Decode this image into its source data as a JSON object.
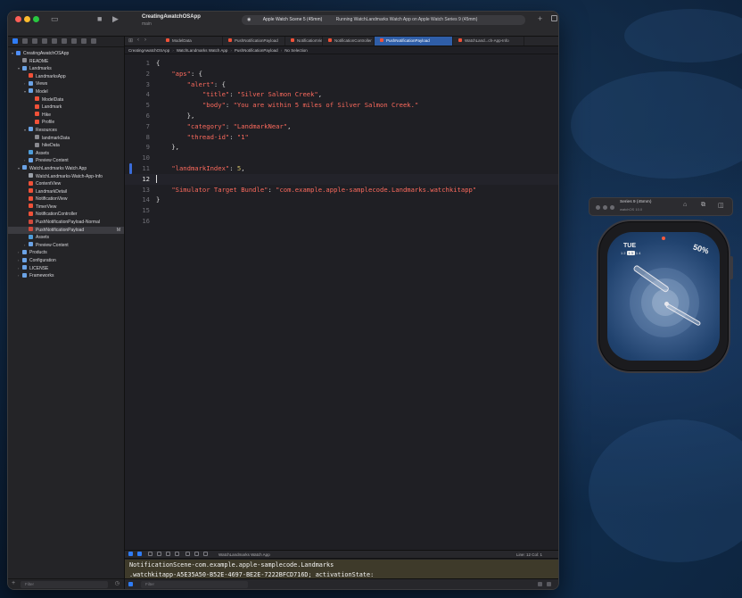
{
  "window": {
    "project_name": "CreatingAwatchOSApp",
    "project_sub": "main",
    "scheme": "Apple Watch Scene 5 (45mm)",
    "run_status": "Running WatchLandmarks Watch App on Apple Watch Series 9 (45mm)"
  },
  "sidebar": {
    "filter_placeholder": "Filter",
    "items": [
      {
        "label": "CreatingAwatchOSApp",
        "depth": 0,
        "arrow": "▾",
        "icon": "proj"
      },
      {
        "label": "README",
        "depth": 1,
        "arrow": "",
        "icon": "json"
      },
      {
        "label": "Landmarks",
        "depth": 1,
        "arrow": "▾",
        "icon": "folder"
      },
      {
        "label": "LandmarksApp",
        "depth": 2,
        "arrow": "",
        "icon": "swift"
      },
      {
        "label": "Views",
        "depth": 2,
        "arrow": "›",
        "icon": "folder"
      },
      {
        "label": "Model",
        "depth": 2,
        "arrow": "▾",
        "icon": "folder"
      },
      {
        "label": "ModelData",
        "depth": 3,
        "arrow": "",
        "icon": "swift"
      },
      {
        "label": "Landmark",
        "depth": 3,
        "arrow": "",
        "icon": "swift"
      },
      {
        "label": "Hike",
        "depth": 3,
        "arrow": "",
        "icon": "swift"
      },
      {
        "label": "Profile",
        "depth": 3,
        "arrow": "",
        "icon": "swift"
      },
      {
        "label": "Resources",
        "depth": 2,
        "arrow": "▾",
        "icon": "folder"
      },
      {
        "label": "landmarkData",
        "depth": 3,
        "arrow": "",
        "icon": "json"
      },
      {
        "label": "hikeData",
        "depth": 3,
        "arrow": "",
        "icon": "json"
      },
      {
        "label": "Assets",
        "depth": 2,
        "arrow": "",
        "icon": "assets"
      },
      {
        "label": "Preview Content",
        "depth": 2,
        "arrow": "›",
        "icon": "folder"
      },
      {
        "label": "WatchLandmarks Watch App",
        "depth": 1,
        "arrow": "▾",
        "icon": "folder"
      },
      {
        "label": "WatchLandmarks-Watch-App-Info",
        "depth": 2,
        "arrow": "",
        "icon": "plist"
      },
      {
        "label": "ContentView",
        "depth": 2,
        "arrow": "",
        "icon": "swift"
      },
      {
        "label": "LandmarkDetail",
        "depth": 2,
        "arrow": "",
        "icon": "swift"
      },
      {
        "label": "NotificationView",
        "depth": 2,
        "arrow": "",
        "icon": "swift"
      },
      {
        "label": "TimerView",
        "depth": 2,
        "arrow": "",
        "icon": "swift"
      },
      {
        "label": "NotificationController",
        "depth": 2,
        "arrow": "",
        "icon": "swift"
      },
      {
        "label": "PushNotificationPayload-Normal",
        "depth": 2,
        "arrow": "",
        "icon": "apns"
      },
      {
        "label": "PushNotificationPayload",
        "depth": 2,
        "arrow": "",
        "icon": "apns",
        "selected": true,
        "badge": "M"
      },
      {
        "label": "Assets",
        "depth": 2,
        "arrow": "",
        "icon": "assets"
      },
      {
        "label": "Preview Content",
        "depth": 2,
        "arrow": "›",
        "icon": "folder"
      },
      {
        "label": "Products",
        "depth": 1,
        "arrow": "›",
        "icon": "folder"
      },
      {
        "label": "Configuration",
        "depth": 1,
        "arrow": "›",
        "icon": "folder"
      },
      {
        "label": "LICENSE",
        "depth": 1,
        "arrow": "›",
        "icon": "folder"
      },
      {
        "label": "Frameworks",
        "depth": 1,
        "arrow": "›",
        "icon": "folder"
      }
    ]
  },
  "tabs": [
    {
      "label": "ModelData",
      "active": false
    },
    {
      "label": "PushNotificationPayload",
      "active": false
    },
    {
      "label": "NotificationView",
      "active": false
    },
    {
      "label": "NotificationController",
      "active": false
    },
    {
      "label": "PushNotificationPayload",
      "active": true
    },
    {
      "label": "WatchLand...ch-App-Info",
      "active": false
    }
  ],
  "breadcrumb": [
    "CreatingAwatchOSApp",
    "WatchLandmarks Watch App",
    "PushNotificationPayload",
    "No Selection"
  ],
  "code_lines": [
    {
      "n": "1",
      "html": "{"
    },
    {
      "n": "2",
      "html": "    <span class=\"str\">\"aps\"</span>: {"
    },
    {
      "n": "3",
      "html": "        <span class=\"str\">\"alert\"</span>: {"
    },
    {
      "n": "4",
      "html": "            <span class=\"str\">\"title\"</span>: <span class=\"str\">\"Silver Salmon Creek\"</span>,"
    },
    {
      "n": "5",
      "html": "            <span class=\"str\">\"body\"</span>: <span class=\"str\">\"You are within 5 miles of Silver Salmon Creek.\"</span>"
    },
    {
      "n": "6",
      "html": "        },"
    },
    {
      "n": "7",
      "html": "        <span class=\"str\">\"category\"</span>: <span class=\"str\">\"LandmarkNear\"</span>,"
    },
    {
      "n": "8",
      "html": "        <span class=\"str\">\"thread-id\"</span>: <span class=\"str\">\"1\"</span>"
    },
    {
      "n": "9",
      "html": "    },"
    },
    {
      "n": "10",
      "html": ""
    },
    {
      "n": "11",
      "html": "    <span class=\"str\">\"landmarkIndex\"</span>: <span class=\"num\">5</span>,"
    },
    {
      "n": "12",
      "html": ""
    },
    {
      "n": "13",
      "html": "    <span class=\"str\">\"Simulator Target Bundle\"</span>: <span class=\"str\">\"com.example.apple-samplecode.Landmarks.watchkitapp\"</span>"
    },
    {
      "n": "14",
      "html": "}"
    },
    {
      "n": "15",
      "html": ""
    },
    {
      "n": "16",
      "html": ""
    }
  ],
  "current_line": "12",
  "changed_line": "11",
  "debug": {
    "target": "WatchLandmarks Watch App",
    "position": "Line: 12  Col: 1"
  },
  "console": {
    "lines": [
      "NotificationScene-com.example.apple-samplecode.Landmarks",
      ".watchkitapp-A5E35A50-B52E-4697-BE2E-7222BFCD716D; activationState:",
      "UISceneActivationStateForegroundActive>"
    ],
    "filter_placeholder": "Filter"
  },
  "simulator": {
    "title": "Series 9 (45mm)",
    "subtitle": "watchOS 10.0"
  },
  "watch_face": {
    "day": "TUE",
    "dates": [
      "12",
      "13",
      "14"
    ],
    "today": "13",
    "battery": "50%"
  }
}
